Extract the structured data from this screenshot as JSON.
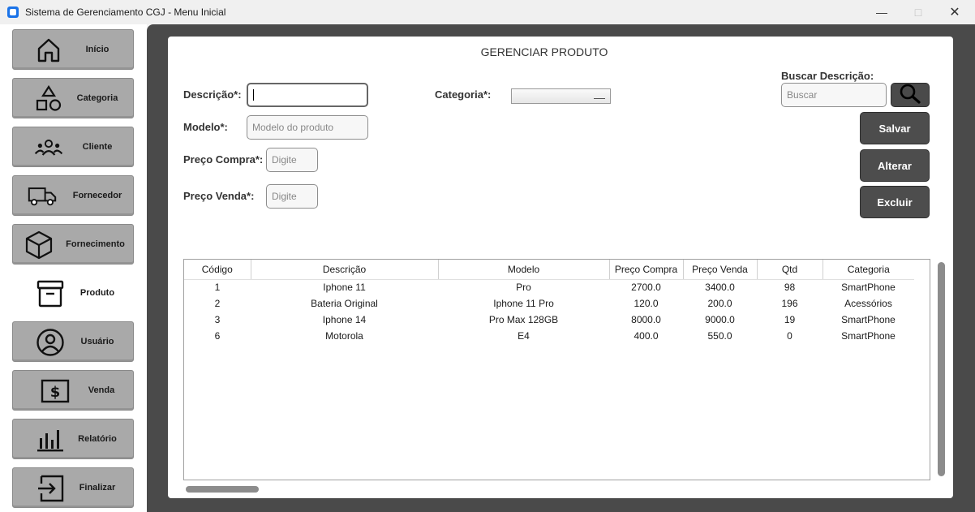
{
  "window": {
    "title": "Sistema de Gerenciamento CGJ - Menu Inicial"
  },
  "sidebar": {
    "items": [
      {
        "label": "Início",
        "icon": "home-icon",
        "active": false
      },
      {
        "label": "Categoria",
        "icon": "shapes-icon",
        "active": false
      },
      {
        "label": "Cliente",
        "icon": "people-icon",
        "active": false
      },
      {
        "label": "Fornecedor",
        "icon": "truck-icon",
        "active": false
      },
      {
        "label": "Fornecimento",
        "icon": "box-icon",
        "active": false
      },
      {
        "label": "Produto",
        "icon": "archive-icon",
        "active": true
      },
      {
        "label": "Usuário",
        "icon": "user-icon",
        "active": false
      },
      {
        "label": "Venda",
        "icon": "dollar-icon",
        "active": false
      },
      {
        "label": "Relatório",
        "icon": "bar-chart-icon",
        "active": false
      },
      {
        "label": "Finalizar",
        "icon": "exit-icon",
        "active": false
      }
    ]
  },
  "form": {
    "title": "GERENCIAR PRODUTO",
    "descricao_label": "Descrição*:",
    "descricao_value": "",
    "categoria_label": "Categoria*:",
    "categoria_value": "",
    "modelo_label": "Modelo*:",
    "modelo_placeholder": "Modelo do produto",
    "preco_compra_label": "Preço Compra*:",
    "preco_compra_placeholder": "Digite",
    "preco_venda_label": "Preço Venda*:",
    "preco_venda_placeholder": "Digite",
    "buscar_label": "Buscar Descrição:",
    "buscar_placeholder": "Buscar"
  },
  "actions": {
    "salvar": "Salvar",
    "alterar": "Alterar",
    "excluir": "Excluir"
  },
  "table": {
    "columns": [
      "Código",
      "Descrição",
      "Modelo",
      "Preço Compra",
      "Preço Venda",
      "Qtd",
      "Categoria"
    ],
    "rows": [
      [
        "1",
        "Iphone 11",
        "Pro",
        "2700.0",
        "3400.0",
        "98",
        "SmartPhone"
      ],
      [
        "2",
        "Bateria Original",
        "Iphone 11 Pro",
        "120.0",
        "200.0",
        "196",
        "Acessórios"
      ],
      [
        "3",
        "Iphone 14",
        "Pro Max 128GB",
        "8000.0",
        "9000.0",
        "19",
        "SmartPhone"
      ],
      [
        "6",
        "Motorola",
        "E4",
        "400.0",
        "550.0",
        "0",
        "SmartPhone"
      ]
    ]
  },
  "colors": {
    "button_dark": "#4d4d4d",
    "sidebar_button": "#a9a9a9",
    "frame": "#4a4a4a"
  }
}
